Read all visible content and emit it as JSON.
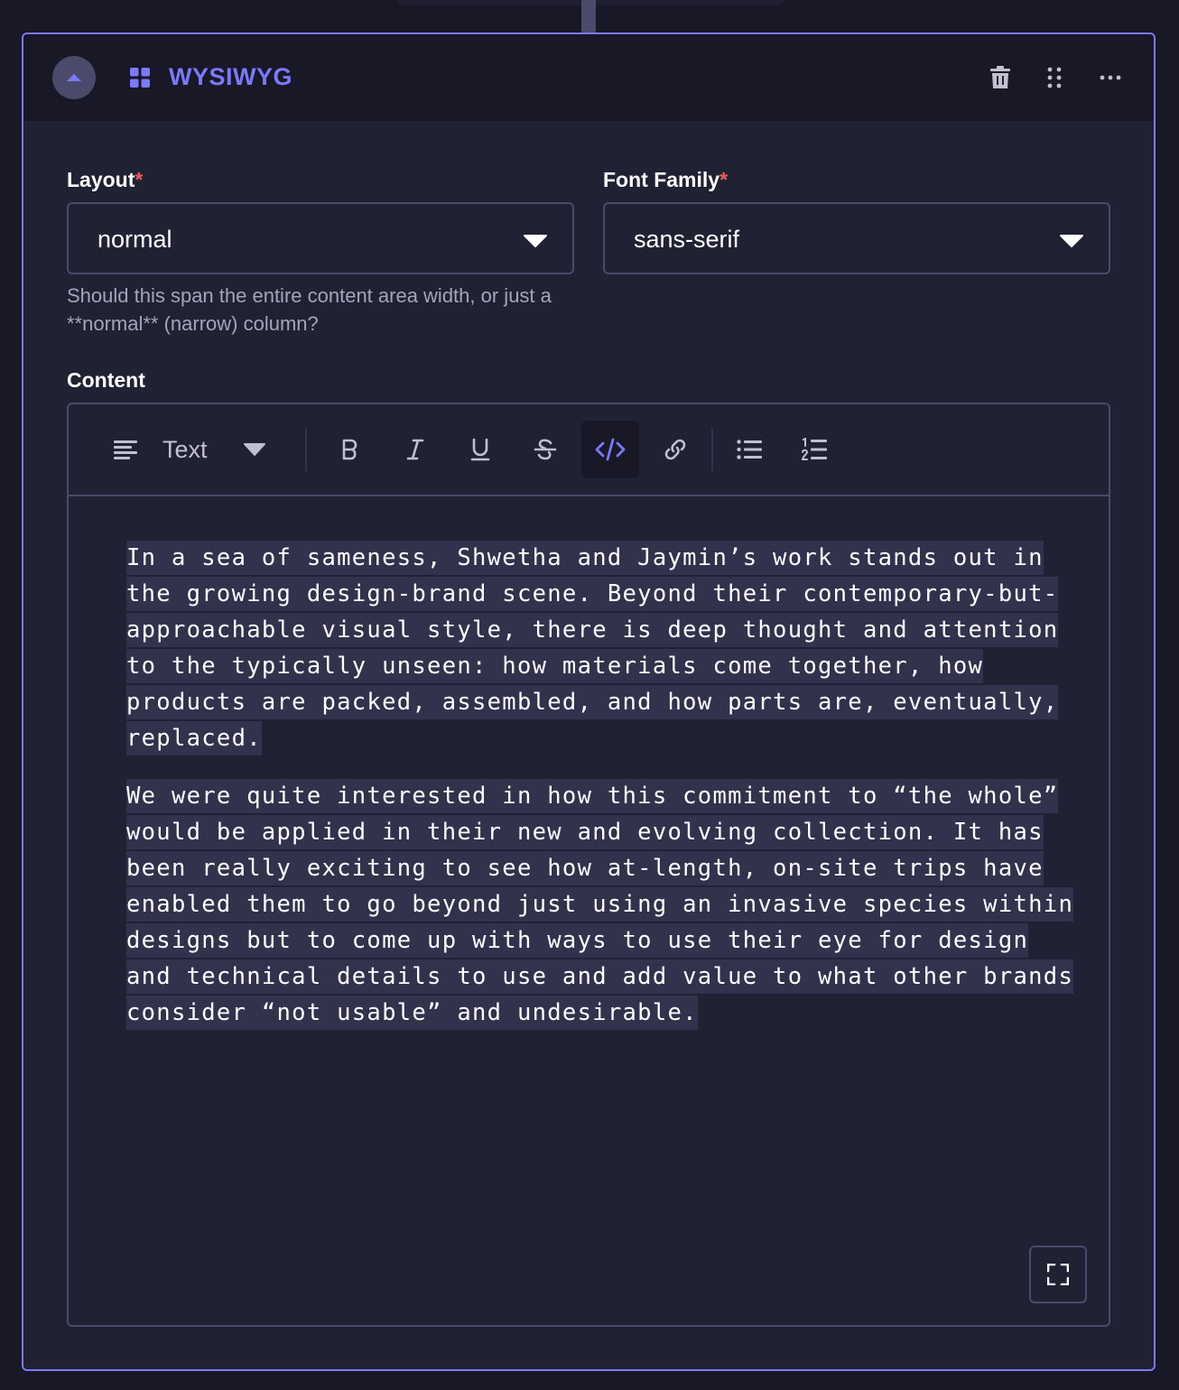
{
  "header": {
    "title": "WYSIWYG",
    "collapse_icon": "chevron-up-icon",
    "component_icon": "grid-icon",
    "actions": [
      "trash-icon",
      "drag-handle-icon",
      "more-icon"
    ]
  },
  "fields": {
    "layout": {
      "label": "Layout",
      "required_mark": "*",
      "value": "normal",
      "hint": "Should this span the entire content area width, or just a **normal** (narrow) column?"
    },
    "font_family": {
      "label": "Font Family",
      "required_mark": "*",
      "value": "sans-serif"
    }
  },
  "content": {
    "label": "Content",
    "toolbar": {
      "block_type": "Text",
      "buttons": [
        "bold",
        "italic",
        "underline",
        "strikethrough",
        "code",
        "link",
        "bullet-list",
        "numbered-list"
      ],
      "active_button": "code"
    },
    "paragraphs": [
      " In a sea of sameness, Shwetha and Jaymin’s work stands out in the growing design-brand scene. Beyond their contemporary-but- approachable visual style, there is deep thought and attention to the typically unseen: how materials come together, how products are packed, assembled, and how parts are, eventually, replaced. ",
      " We were quite interested in how this commitment to “the whole” would be applied in their new and evolving collection. It has been really exciting to see how at-length, on-site trips have enabled them to go beyond just using an invasive species within designs but to come up with ways to use their eye for design and technical details to use and add value to what other brands consider “not usable” and undesirable. "
    ]
  },
  "colors": {
    "accent": "#7b79ff",
    "required": "#ee5e52",
    "background": "#212134",
    "header_background": "#181826",
    "border": "#4a4a6a"
  }
}
